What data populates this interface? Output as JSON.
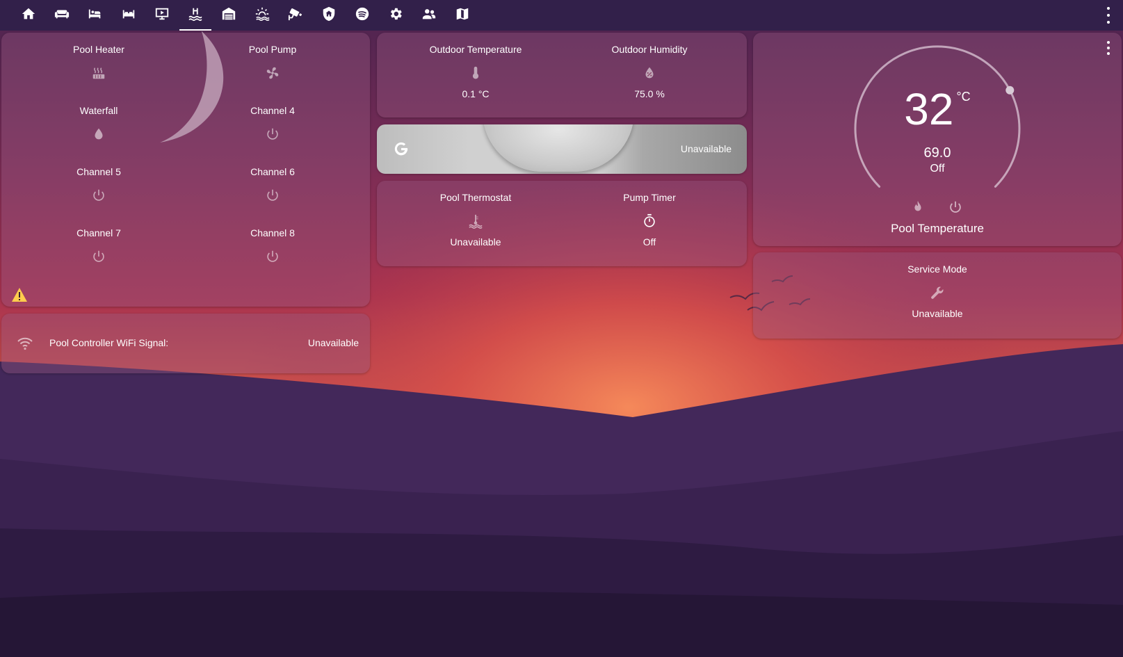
{
  "nav": {
    "tabs": [
      {
        "icon": "home-icon"
      },
      {
        "icon": "sofa-icon"
      },
      {
        "icon": "bed-icon"
      },
      {
        "icon": "bed-double-icon"
      },
      {
        "icon": "projector-screen-icon"
      },
      {
        "icon": "pool-icon",
        "active": true
      },
      {
        "icon": "garage-icon"
      },
      {
        "icon": "weather-icon"
      },
      {
        "icon": "cctv-icon"
      },
      {
        "icon": "shield-home-icon"
      },
      {
        "icon": "spotify-icon"
      },
      {
        "icon": "cog-icon"
      },
      {
        "icon": "account-group-icon"
      },
      {
        "icon": "map-icon"
      }
    ],
    "menu_icon": "dots-vertical-icon"
  },
  "pool_controls": {
    "items": [
      {
        "name": "Pool Heater",
        "icon": "heat-icon"
      },
      {
        "name": "Pool Pump",
        "icon": "fan-icon"
      },
      {
        "name": "Waterfall",
        "icon": "water-drop-icon"
      },
      {
        "name": "Channel 4",
        "icon": "power-icon"
      },
      {
        "name": "Channel 5",
        "icon": "power-icon"
      },
      {
        "name": "Channel 6",
        "icon": "power-icon"
      },
      {
        "name": "Channel 7",
        "icon": "power-icon"
      },
      {
        "name": "Channel 8",
        "icon": "power-icon"
      }
    ],
    "warning_icon": "alert-icon",
    "warning_color": "#ffcc4d"
  },
  "wifi": {
    "label": "Pool Controller WiFi Signal:",
    "value": "Unavailable",
    "icon": "wifi-icon"
  },
  "outdoor": {
    "temperature": {
      "name": "Outdoor Temperature",
      "value": "0.1 °C",
      "icon": "thermometer-icon"
    },
    "humidity": {
      "name": "Outdoor Humidity",
      "value": "75.0 %",
      "icon": "water-percent-icon"
    }
  },
  "media": {
    "status": "Unavailable",
    "icon": "google-icon"
  },
  "pool_status": {
    "thermostat": {
      "name": "Pool Thermostat",
      "value": "Unavailable",
      "icon": "pool-thermometer-icon"
    },
    "timer": {
      "name": "Pump Timer",
      "value": "Off",
      "icon": "timer-icon"
    }
  },
  "thermostat": {
    "target": "32",
    "unit": "°C",
    "current": "69.0",
    "mode": "Off",
    "name": "Pool Temperature",
    "level": 0.73
  },
  "service": {
    "name": "Service Mode",
    "value": "Unavailable",
    "icon": "wrench-icon"
  }
}
